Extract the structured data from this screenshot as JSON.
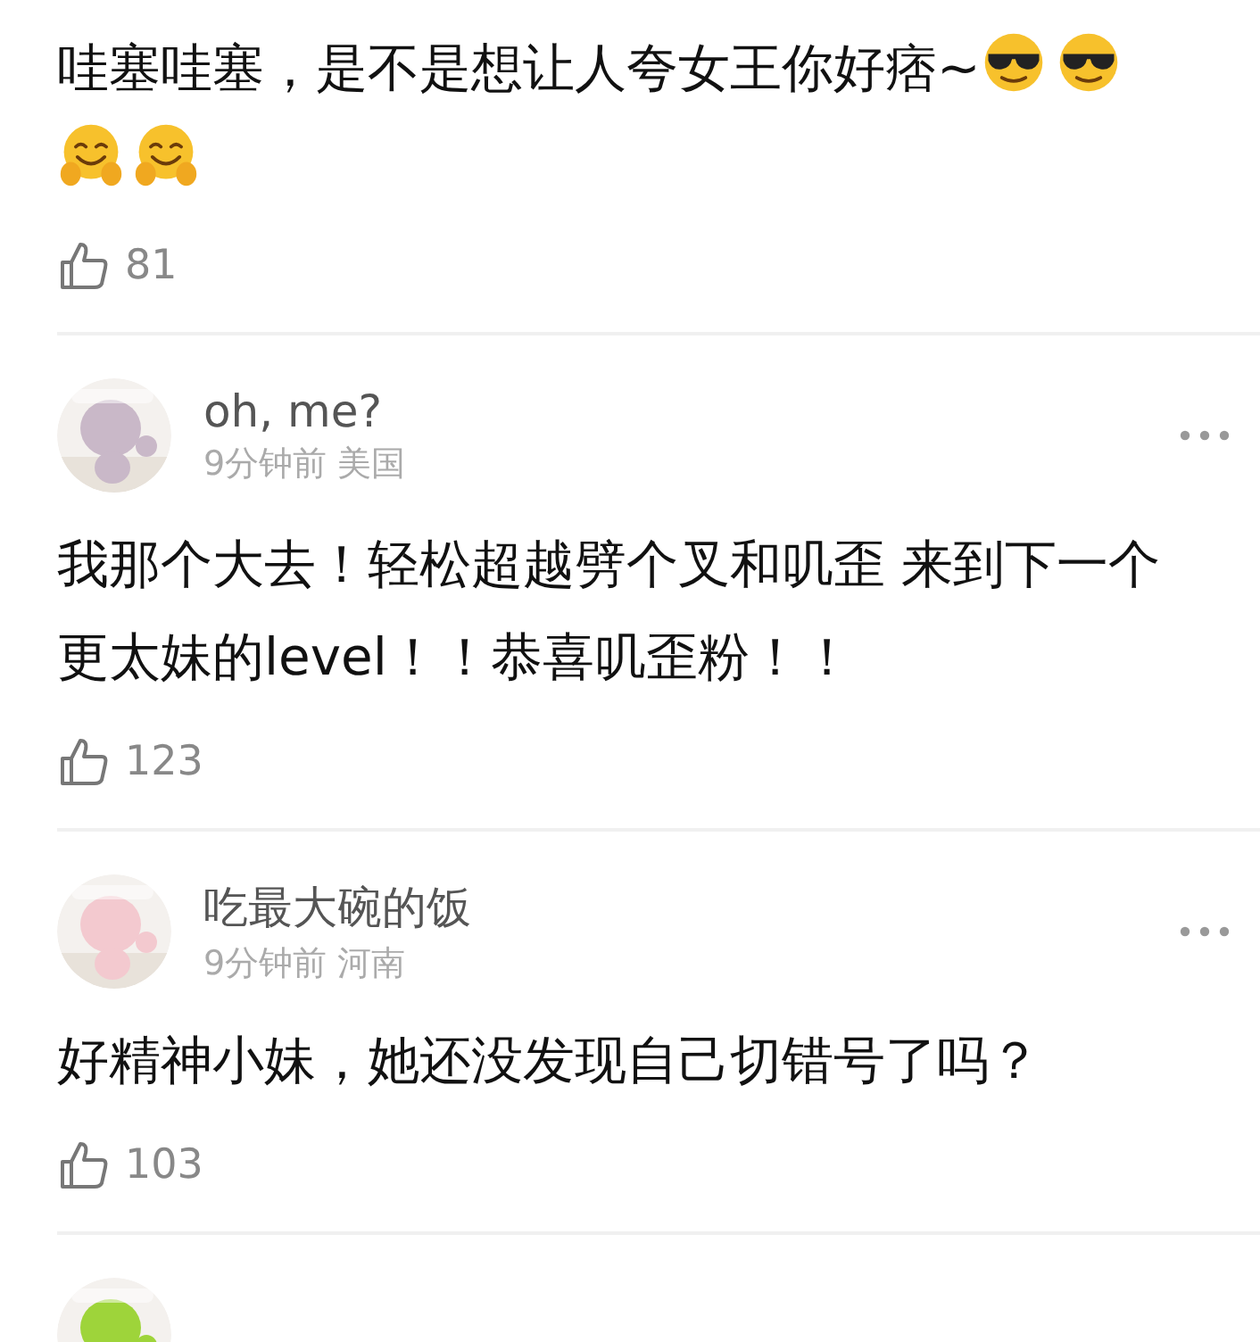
{
  "comments": [
    {
      "text": "哇塞哇塞，是不是想让人夸女王你好痞~",
      "emojis": [
        {
          "kind": "sunglasses"
        },
        {
          "kind": "sunglasses"
        },
        {
          "kind": "hug"
        },
        {
          "kind": "hug"
        }
      ],
      "likes": "81"
    },
    {
      "avatar": {
        "kind": "picture"
      },
      "author": "oh, me?",
      "time": "9分钟前",
      "location": "美国",
      "text": "我那个大去！轻松超越劈个叉和叽歪 来到下一个更太妹的level！！恭喜叽歪粉！！",
      "likes": "123"
    },
    {
      "avatar": {
        "kind": "picture"
      },
      "author": "吃最大碗的饭",
      "time": "9分钟前",
      "location": "河南",
      "text": "好精神小妹，她还没发现自己切错号了吗？",
      "likes": "103"
    },
    {
      "avatar": {
        "kind": "picture"
      }
    }
  ]
}
